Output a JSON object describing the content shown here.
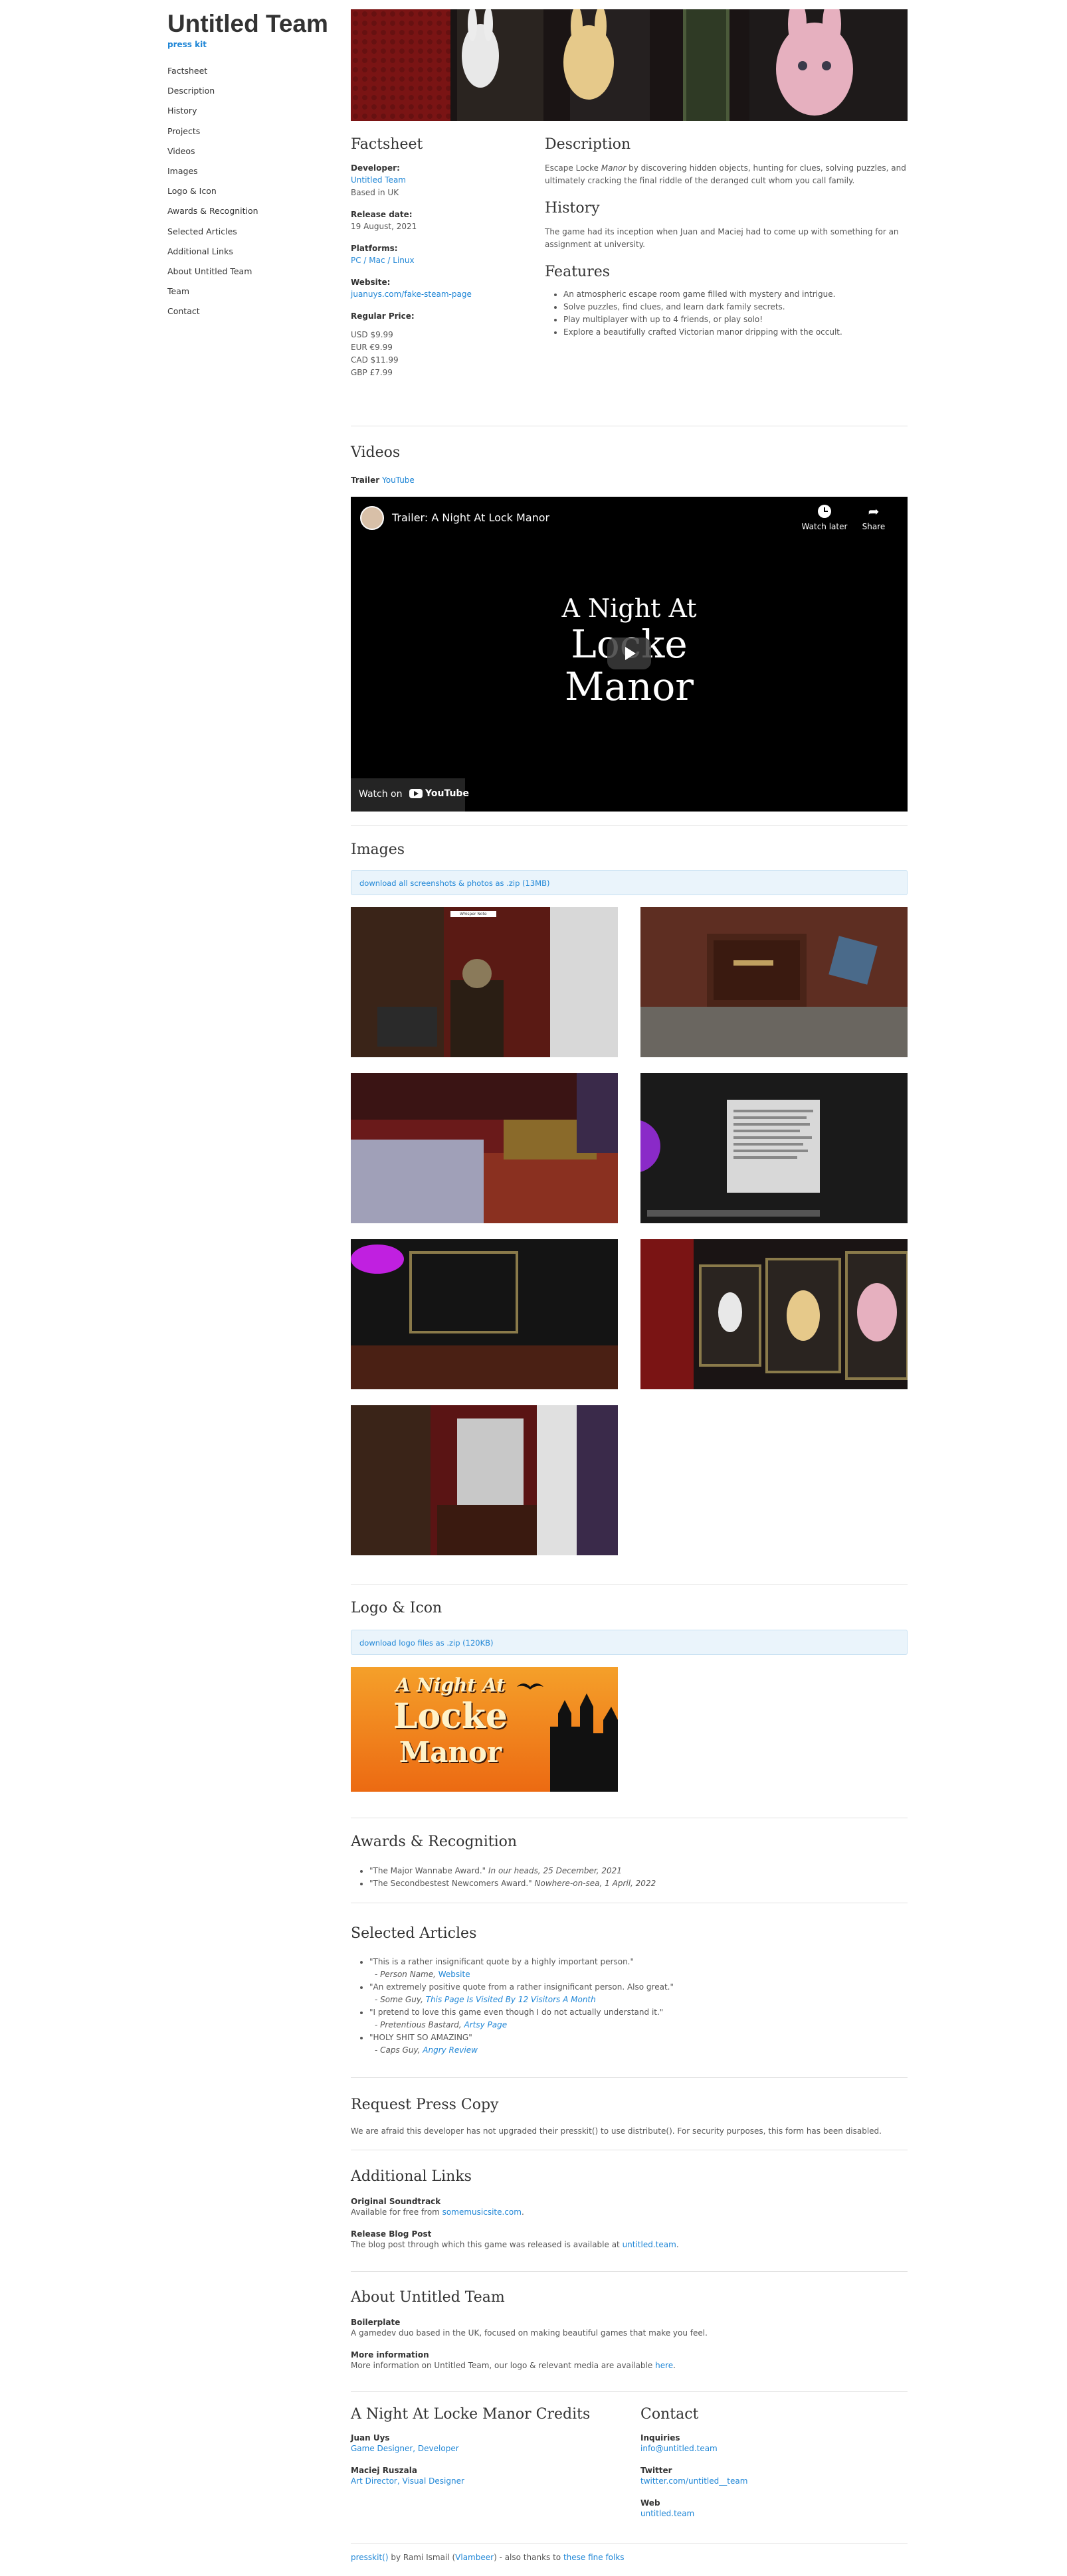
{
  "sidebar": {
    "title": "Untitled Team",
    "presskit": "press kit",
    "nav": [
      "Factsheet",
      "Description",
      "History",
      "Projects",
      "Videos",
      "Images",
      "Logo & Icon",
      "Awards & Recognition",
      "Selected Articles",
      "Additional Links",
      "About Untitled Team",
      "Team",
      "Contact"
    ]
  },
  "factsheet": {
    "heading": "Factsheet",
    "developer_label": "Developer:",
    "developer_name": "Untitled Team",
    "developer_location": "Based in UK",
    "release_label": "Release date:",
    "release_date": "19 August, 2021",
    "platforms_label": "Platforms:",
    "platforms": "PC / Mac / Linux",
    "website_label": "Website:",
    "website": "juanuys.com/fake-steam-page",
    "price_label": "Regular Price:",
    "prices": [
      "USD $9.99",
      "EUR €9.99",
      "CAD $11.99",
      "GBP £7.99"
    ]
  },
  "description": {
    "heading": "Description",
    "text_prefix": "Escape Locke ",
    "text_em": "Manor",
    "text_rest": " by discovering hidden objects, hunting for clues, solving puzzles, and ultimately cracking the final riddle of the deranged cult whom you call family."
  },
  "history": {
    "heading": "History",
    "text": "The game had its inception when Juan and Maciej had to come up with something for an assignment at university."
  },
  "features": {
    "heading": "Features",
    "items": [
      "An atmospheric escape room game filled with mystery and intrigue.",
      "Solve puzzles, find clues, and learn dark family secrets.",
      "Play multiplayer with up to 4 friends, or play solo!",
      "Explore a beautifully crafted Victorian manor dripping with the occult."
    ]
  },
  "videos": {
    "heading": "Videos",
    "trailer_label": "Trailer",
    "trailer_link": "YouTube",
    "player_title": "Trailer: A Night At Lock Manor",
    "watch_later": "Watch later",
    "share": "Share",
    "overlay_line1": "A Night At",
    "overlay_line2": "Locke",
    "overlay_line3": "Manor",
    "watch_on": "Watch on",
    "youtube": "YouTube"
  },
  "images": {
    "heading": "Images",
    "download": "download all screenshots & photos as .zip (13MB)",
    "note_label": "Whisper Note"
  },
  "logo": {
    "heading": "Logo & Icon",
    "download": "download logo files as .zip (120KB)",
    "line1": "A Night At",
    "line2": "Locke",
    "line3": "Manor"
  },
  "awards": {
    "heading": "Awards & Recognition",
    "items": [
      {
        "quote": "\"The Major Wannabe Award.\"",
        "source": " In our heads, 25 December, 2021"
      },
      {
        "quote": "\"The Secondbestest Newcomers Award.\"",
        "source": " Nowhere-on-sea, 1 April, 2022"
      }
    ]
  },
  "articles": {
    "heading": "Selected Articles",
    "items": [
      {
        "quote": "\"This is a rather insignificant quote by a highly important person.\"",
        "author": "- Person Name, ",
        "link": "Website"
      },
      {
        "quote": "\"An extremely positive quote from a rather insignificant person. Also great.\"",
        "author": "- Some Guy, ",
        "link": "This Page Is Visited By 12 Visitors A Month"
      },
      {
        "quote": "\"I pretend to love this game even though I do not actually understand it.\"",
        "author": "- Pretentious Bastard, ",
        "link": "Artsy Page"
      },
      {
        "quote": "\"HOLY SHIT SO AMAZING\"",
        "author": "- Caps Guy, ",
        "link": "Angry Review"
      }
    ]
  },
  "press_copy": {
    "heading": "Request Press Copy",
    "text": "We are afraid this developer has not upgraded their presskit() to use distribute(). For security purposes, this form has been disabled."
  },
  "additional_links": {
    "heading": "Additional Links",
    "soundtrack_label": "Original Soundtrack",
    "soundtrack_text": "Available for free from ",
    "soundtrack_link": "somemusicsite.com",
    "blog_label": "Release Blog Post",
    "blog_text": "The blog post through which this game was released is available at ",
    "blog_link": "untitled.team"
  },
  "about": {
    "heading": "About Untitled Team",
    "boilerplate_label": "Boilerplate",
    "boilerplate": "A gamedev duo based in the UK, focused on making beautiful games that make you feel.",
    "more_label": "More information",
    "more_text": "More information on Untitled Team, our logo & relevant media are available ",
    "more_link": "here"
  },
  "credits": {
    "heading": "A Night At Locke Manor Credits",
    "people": [
      {
        "name": "Juan Uys",
        "role": "Game Designer, Developer"
      },
      {
        "name": "Maciej Ruszala",
        "role": "Art Director, Visual Designer"
      }
    ]
  },
  "contact": {
    "heading": "Contact",
    "items": [
      {
        "label": "Inquiries",
        "value": "info@untitled.team"
      },
      {
        "label": "Twitter",
        "value": "twitter.com/untitled__team"
      },
      {
        "label": "Web",
        "value": "untitled.team"
      }
    ]
  },
  "footer": {
    "presskit": "presskit()",
    "by": " by Rami Ismail (",
    "vlambeer": "Vlambeer",
    "thanks": ") - also thanks to ",
    "folks": "these fine folks"
  },
  "colors": {
    "link": "#1f86d6",
    "note_bg": "#eaf4fb",
    "logo_orange": "#f08a1f"
  }
}
